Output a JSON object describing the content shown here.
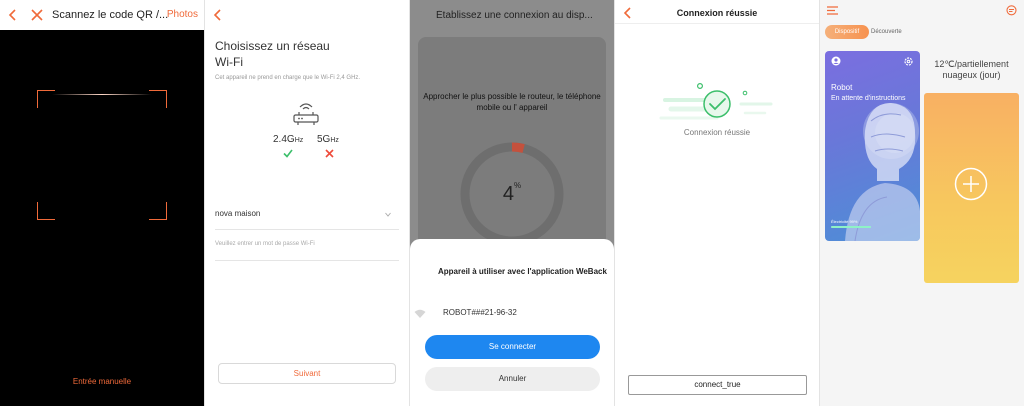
{
  "scanner": {
    "title": "Scannez le code QR /...",
    "photos_label": "Photos",
    "manual_entry": "Entrée manuelle"
  },
  "wifi": {
    "title_line1": "Choisissez un réseau",
    "title_line2": "Wi-Fi",
    "note": "Cet appareil ne prend en charge que le Wi-Fi 2,4 GHz.",
    "band_24": "2.4G",
    "band_5": "5G",
    "band_unit": "Hz",
    "ssid": "nova maison",
    "password_placeholder": "Veuillez entrer un mot de passe Wi-Fi",
    "next_button": "Suivant",
    "colors": {
      "accent": "#f06a3a",
      "ok": "#3cbf6b",
      "bad": "#ee4b3b"
    }
  },
  "connecting": {
    "title": "Établissez une connexion au disp...",
    "message": "Approcher le plus possible le routeur, le téléphone mobile ou l' appareil",
    "progress_value": "4",
    "progress_unit": "%",
    "progress_fraction": 0.04,
    "sheet_title": "Appareil à utiliser avec l'application WeBack",
    "device_name": "ROBOT###21-96-32",
    "connect_button": "Se connecter",
    "cancel_button": "Annuler",
    "colors": {
      "primary": "#1e87f0"
    }
  },
  "success": {
    "title": "Connexion réussie",
    "message": "Connexion réussie",
    "button": "connect_true",
    "colors": {
      "check": "#3cbf6b"
    }
  },
  "home": {
    "tab_active": "Dispositif",
    "tab_inactive": "Découverte",
    "device_name": "Robot",
    "device_status": "En attente d'instructions",
    "battery_label": "Électricité 99%",
    "battery_level": 0.99,
    "weather_line1": "12℃/partiellement",
    "weather_line2": "nuageux (jour)",
    "icons": [
      "menu-icon",
      "message-icon",
      "user-icon",
      "gear-icon",
      "plus-icon"
    ]
  }
}
